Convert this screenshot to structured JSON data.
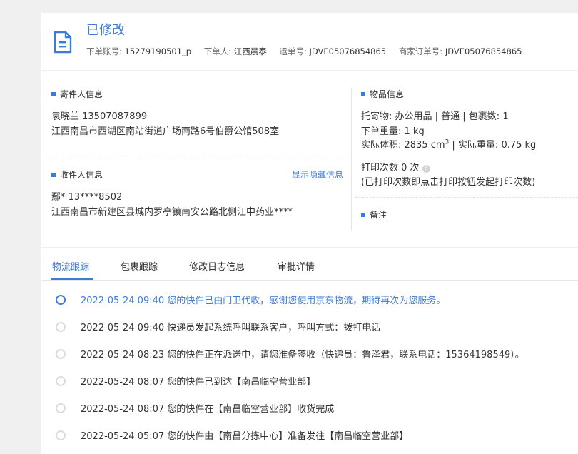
{
  "header": {
    "status": "已修改",
    "meta": [
      {
        "label": "下单账号:",
        "value": "15279190501_p"
      },
      {
        "label": "下单人:",
        "value": "江西晨泰"
      },
      {
        "label": "运单号:",
        "value": "JDVE05076854865"
      },
      {
        "label": "商家订单号:",
        "value": "JDVE05076854865"
      }
    ]
  },
  "sender": {
    "title": "寄件人信息",
    "name_phone": "袁晓兰   13507087899",
    "address": "江西南昌市西湖区南站街道广场南路6号伯爵公馆508室"
  },
  "receiver": {
    "title": "收件人信息",
    "show_hidden": "显示隐藏信息",
    "name_phone": "鄢*   13****8502",
    "address": "江西南昌市新建区县城内罗亭镇南安公路北侧江中药业****"
  },
  "goods": {
    "title": "物品信息",
    "line1": "托寄物:  办公用品 | 普通  | 包裹数:  1",
    "line2": "下单重量:  1 kg",
    "line3_a": "实际体积:   2835 cm",
    "line3_sup": "3",
    "line3_b": " |  实际重量:  0.75 kg",
    "print_count": "打印次数   0 次",
    "print_hint": "(已打印次数即点击打印按钮发起打印次数)"
  },
  "remark": {
    "title": "备注"
  },
  "tabs": [
    "物流跟踪",
    "包裹跟踪",
    "修改日志信息",
    "审批详情"
  ],
  "timeline": [
    "2022-05-24 09:40 您的快件已由门卫代收，感谢您使用京东物流，期待再次为您服务。",
    "2022-05-24 09:40 快递员发起系统呼叫联系客户，呼叫方式：拨打电话",
    "2022-05-24 08:23 您的快件正在派送中，请您准备签收（快递员：鲁泽君，联系电话：15364198549）。",
    "2022-05-24 08:07 您的快件已到达【南昌临空营业部】",
    "2022-05-24 08:07 您的快件在【南昌临空营业部】收货完成",
    "2022-05-24 05:07 您的快件由【南昌分拣中心】准备发往【南昌临空营业部】"
  ],
  "colors": {
    "accent": "#3c7bd6"
  },
  "icons": {
    "header": "document-icon",
    "help": "help-icon"
  }
}
